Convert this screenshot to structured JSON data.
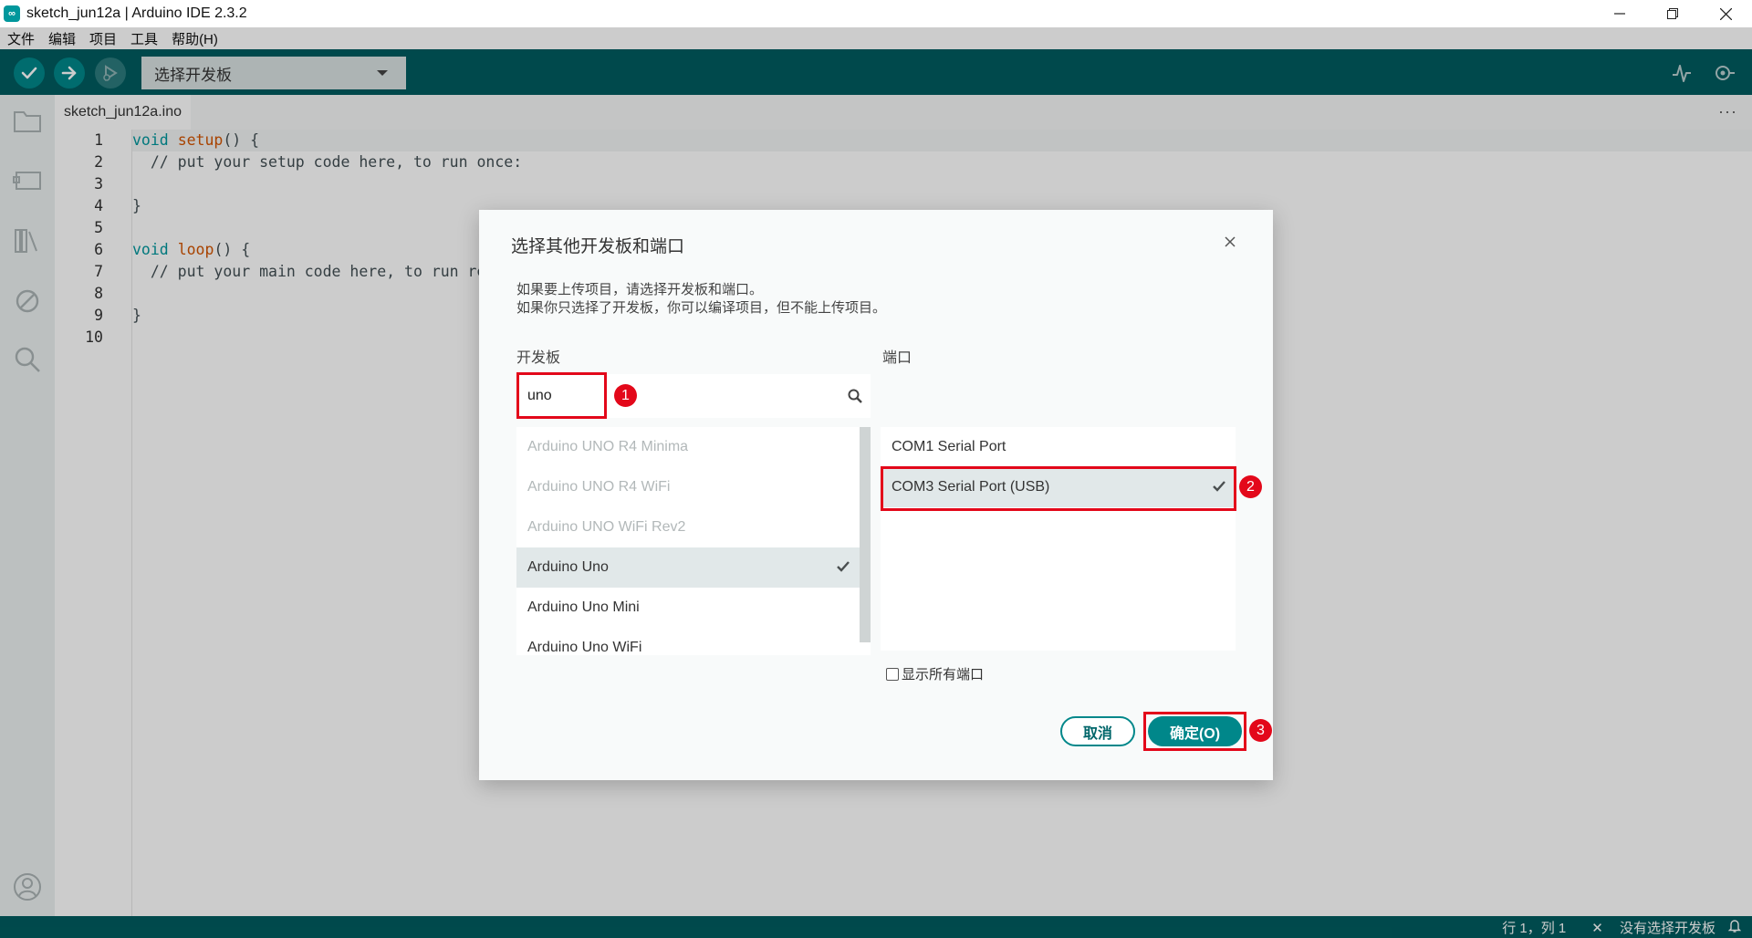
{
  "window": {
    "title": "sketch_jun12a | Arduino IDE 2.3.2",
    "controls": [
      "minimize-icon",
      "restore-icon",
      "close-icon"
    ]
  },
  "menu": [
    "文件",
    "编辑",
    "项目",
    "工具",
    "帮助(H)"
  ],
  "toolbar": {
    "board_select_label": "选择开发板",
    "buttons": [
      "verify-icon",
      "upload-icon",
      "debug-icon"
    ],
    "right_icons": [
      "serial-plotter-icon",
      "serial-monitor-icon"
    ]
  },
  "sidebar": {
    "icons": [
      "folder-icon",
      "board-manager-icon",
      "library-manager-icon",
      "debug-icon",
      "search-icon",
      "account-icon"
    ]
  },
  "editor": {
    "tab_label": "sketch_jun12a.ino",
    "more_label": "···",
    "lines": [
      {
        "num": "1",
        "text": "void setup() {"
      },
      {
        "num": "2",
        "text": "  // put your setup code here, to run once:"
      },
      {
        "num": "3",
        "text": ""
      },
      {
        "num": "4",
        "text": "}"
      },
      {
        "num": "5",
        "text": ""
      },
      {
        "num": "6",
        "text": "void loop() {"
      },
      {
        "num": "7",
        "text": "  // put your main code here, to run repeatedly:"
      },
      {
        "num": "8",
        "text": ""
      },
      {
        "num": "9",
        "text": "}"
      },
      {
        "num": "10",
        "text": ""
      }
    ]
  },
  "status_bar": {
    "position": "行 1，列 1",
    "board_status": "没有选择开发板"
  },
  "dialog": {
    "title": "选择其他开发板和端口",
    "desc_line1": "如果要上传项目，请选择开发板和端口。",
    "desc_line2": "如果你只选择了开发板，你可以编译项目，但不能上传项目。",
    "board_label": "开发板",
    "port_label": "端口",
    "search_value": "uno",
    "boards": [
      {
        "name": "Arduino UNO R4 Minima",
        "state": "disabled"
      },
      {
        "name": "Arduino UNO R4 WiFi",
        "state": "disabled"
      },
      {
        "name": "Arduino UNO WiFi Rev2",
        "state": "disabled"
      },
      {
        "name": "Arduino Uno",
        "state": "selected"
      },
      {
        "name": "Arduino Uno Mini",
        "state": "normal"
      },
      {
        "name": "Arduino Uno WiFi",
        "state": "normal"
      }
    ],
    "ports": [
      {
        "name": "COM1 Serial Port",
        "state": "normal"
      },
      {
        "name": "COM3 Serial Port (USB)",
        "state": "selected"
      }
    ],
    "show_all_ports_label": "显示所有端口",
    "show_all_ports_checked": false,
    "cancel_label": "取消",
    "ok_label": "确定(O)"
  },
  "annotations": [
    "1",
    "2",
    "3"
  ],
  "colors": {
    "toolbar": "#005c5f",
    "accent": "#00878a",
    "annotation": "#e3081a",
    "keyword": "#00979d",
    "function": "#d35400",
    "comment": "#95a5a6"
  }
}
